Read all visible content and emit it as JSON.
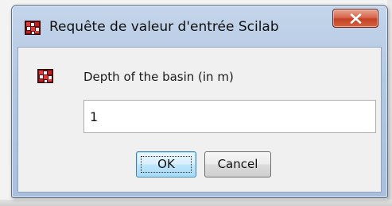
{
  "window": {
    "title": "Requête de valeur d'entrée Scilab",
    "app_icon": "scilab-icon",
    "close_icon": "close-icon"
  },
  "dialog": {
    "prompt_icon": "scilab-icon",
    "prompt_label": "Depth of the basin (in m)",
    "input_value": "1",
    "ok_label": "OK",
    "cancel_label": "Cancel"
  },
  "colors": {
    "title_frame": "#b4c8e2",
    "close_button": "#c94a2e",
    "default_button_border": "#3c7fb1"
  }
}
